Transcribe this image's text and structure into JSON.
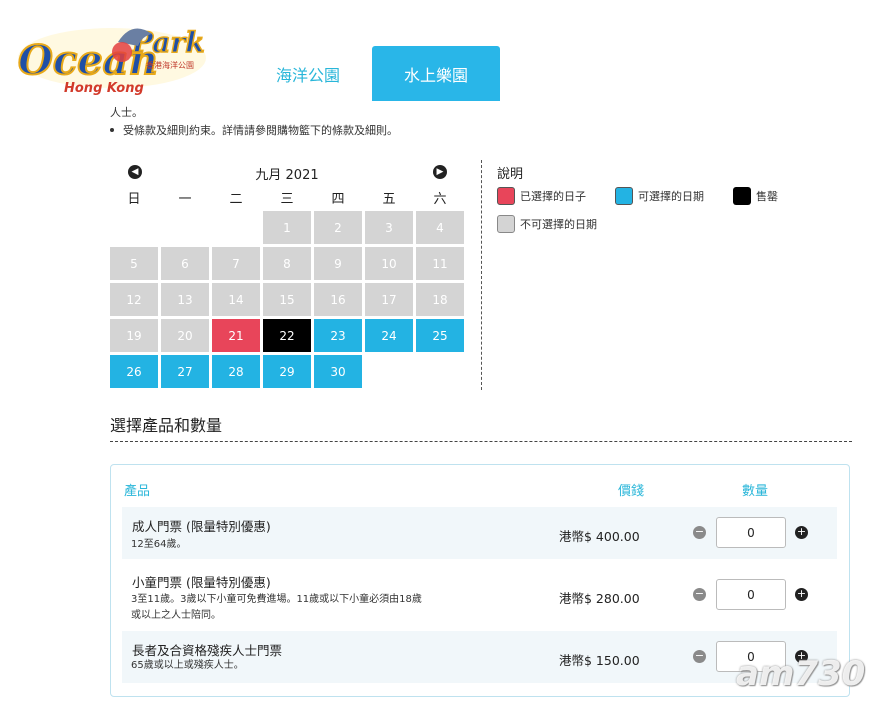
{
  "logo": {
    "text": "Ocean Park",
    "sub": "Hong Kong",
    "sub_cn": "香港海洋公園"
  },
  "tabs": {
    "ocean_park": "海洋公園",
    "water_world": "水上樂園"
  },
  "notes": {
    "line1": "人士。",
    "line2": "受條款及細則約束。詳情請參閱購物籃下的條款及細則。"
  },
  "calendar": {
    "month": "九月 2021",
    "weekdays": [
      "日",
      "一",
      "二",
      "三",
      "四",
      "五",
      "六"
    ],
    "days": [
      {
        "d": "",
        "s": "empty"
      },
      {
        "d": "",
        "s": "empty"
      },
      {
        "d": "",
        "s": "empty"
      },
      {
        "d": "1",
        "s": "unavailable"
      },
      {
        "d": "2",
        "s": "unavailable"
      },
      {
        "d": "3",
        "s": "unavailable"
      },
      {
        "d": "4",
        "s": "unavailable"
      },
      {
        "d": "5",
        "s": "unavailable"
      },
      {
        "d": "6",
        "s": "unavailable"
      },
      {
        "d": "7",
        "s": "unavailable"
      },
      {
        "d": "8",
        "s": "unavailable"
      },
      {
        "d": "9",
        "s": "unavailable"
      },
      {
        "d": "10",
        "s": "unavailable"
      },
      {
        "d": "11",
        "s": "unavailable"
      },
      {
        "d": "12",
        "s": "unavailable"
      },
      {
        "d": "13",
        "s": "unavailable"
      },
      {
        "d": "14",
        "s": "unavailable"
      },
      {
        "d": "15",
        "s": "unavailable"
      },
      {
        "d": "16",
        "s": "unavailable"
      },
      {
        "d": "17",
        "s": "unavailable"
      },
      {
        "d": "18",
        "s": "unavailable"
      },
      {
        "d": "19",
        "s": "unavailable"
      },
      {
        "d": "20",
        "s": "unavailable"
      },
      {
        "d": "21",
        "s": "selected"
      },
      {
        "d": "22",
        "s": "soldout"
      },
      {
        "d": "23",
        "s": "available"
      },
      {
        "d": "24",
        "s": "available"
      },
      {
        "d": "25",
        "s": "available"
      },
      {
        "d": "26",
        "s": "available"
      },
      {
        "d": "27",
        "s": "available"
      },
      {
        "d": "28",
        "s": "available"
      },
      {
        "d": "29",
        "s": "available"
      },
      {
        "d": "30",
        "s": "available"
      }
    ]
  },
  "legend": {
    "title": "說明",
    "selected": "已選擇的日子",
    "available": "可選擇的日期",
    "soldout": "售罄",
    "unavailable": "不可選擇的日期"
  },
  "section": {
    "title": "選擇產品和數量"
  },
  "products": {
    "headers": {
      "product": "產品",
      "price": "價錢",
      "quantity": "數量"
    },
    "items": [
      {
        "name": "成人門票 (限量特別優惠)",
        "desc1": "12至64歲。",
        "desc2": "",
        "price": "港幣$ 400.00",
        "qty": "0"
      },
      {
        "name": "小童門票 (限量特別優惠)",
        "desc1": "3至11歲。3歲以下小童可免費進場。11歲或以下小童必須由18歲",
        "desc2": "或以上之人士陪同。",
        "price": "港幣$ 280.00",
        "qty": "0"
      },
      {
        "name": "長者及合資格殘疾人士門票",
        "desc1": "65歲或以上或殘疾人士。",
        "desc2": "",
        "price": "港幣$ 150.00",
        "qty": "0"
      }
    ]
  },
  "watermark": "am730",
  "colors": {
    "accent": "#29b6e8",
    "selected": "#e8455a",
    "available": "#23b3e3",
    "soldout": "#000000",
    "unavailable": "#d4d4d4"
  }
}
